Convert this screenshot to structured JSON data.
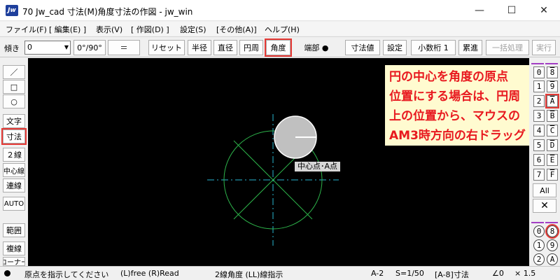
{
  "window": {
    "app_icon": "Jw",
    "title": "70 Jw_cad 寸法(M)角度寸法の作図 - jw_win",
    "minimize": "—",
    "maximize": "☐",
    "close": "✕"
  },
  "menu": [
    "ファイル(F)",
    "[ 編集(E) ]",
    "表示(V)",
    "[ 作図(D) ]",
    "設定(S)",
    "[その他(A)]",
    "ヘルプ(H)"
  ],
  "toolbar": {
    "tilt_label": "傾き",
    "tilt_value": "0",
    "angle_toggle": "0°/90°",
    "equal": "＝",
    "reset": "リセット",
    "radius": "半径",
    "diameter": "直径",
    "circumference": "円周",
    "angle": "角度",
    "endpoint": "端部 ●",
    "dim_value": "寸法値",
    "settings": "設定",
    "decimals": "小数桁 1",
    "cumulative": "累進",
    "batch": "一括処理",
    "execute": "実行"
  },
  "left_tools": [
    "／",
    "□",
    "○",
    "文字",
    "寸法",
    "２線",
    "中心線",
    "連線",
    "AUTO",
    "範囲",
    "複線",
    "コーナー"
  ],
  "callout": {
    "text": "円の中心を角度の原点\n位置にする場合は、円周\n上の位置から、マウスの\nAM3時方向の右ドラッグ"
  },
  "snap_label": "中心点･A点",
  "right_panel": {
    "layer_left": [
      "0",
      "1",
      "2",
      "3",
      "4",
      "5",
      "6",
      "7"
    ],
    "layer_right": [
      "8",
      "9",
      "A",
      "B",
      "C",
      "D",
      "E",
      "F"
    ],
    "all": "All",
    "cross": "✕",
    "group_left": [
      "0",
      "1",
      "2"
    ],
    "group_right": [
      "8",
      "9",
      "A"
    ]
  },
  "status": {
    "message": "原点を指示してください",
    "mouse": "(L)free  (R)Read",
    "mode": "2線角度 (LL)線指示",
    "paper": "A-2",
    "scale": "S=1/50",
    "layer": "[A-8]寸法",
    "angle": "∠0",
    "zoom": "× 1.5"
  },
  "colors": {
    "callout_text": "#e8191f",
    "callout_bg": "#fffbd0",
    "highlight": "#e53935",
    "canvas_bg": "#000000",
    "circle_line": "#2db34a",
    "center_line": "#29b6d0"
  }
}
